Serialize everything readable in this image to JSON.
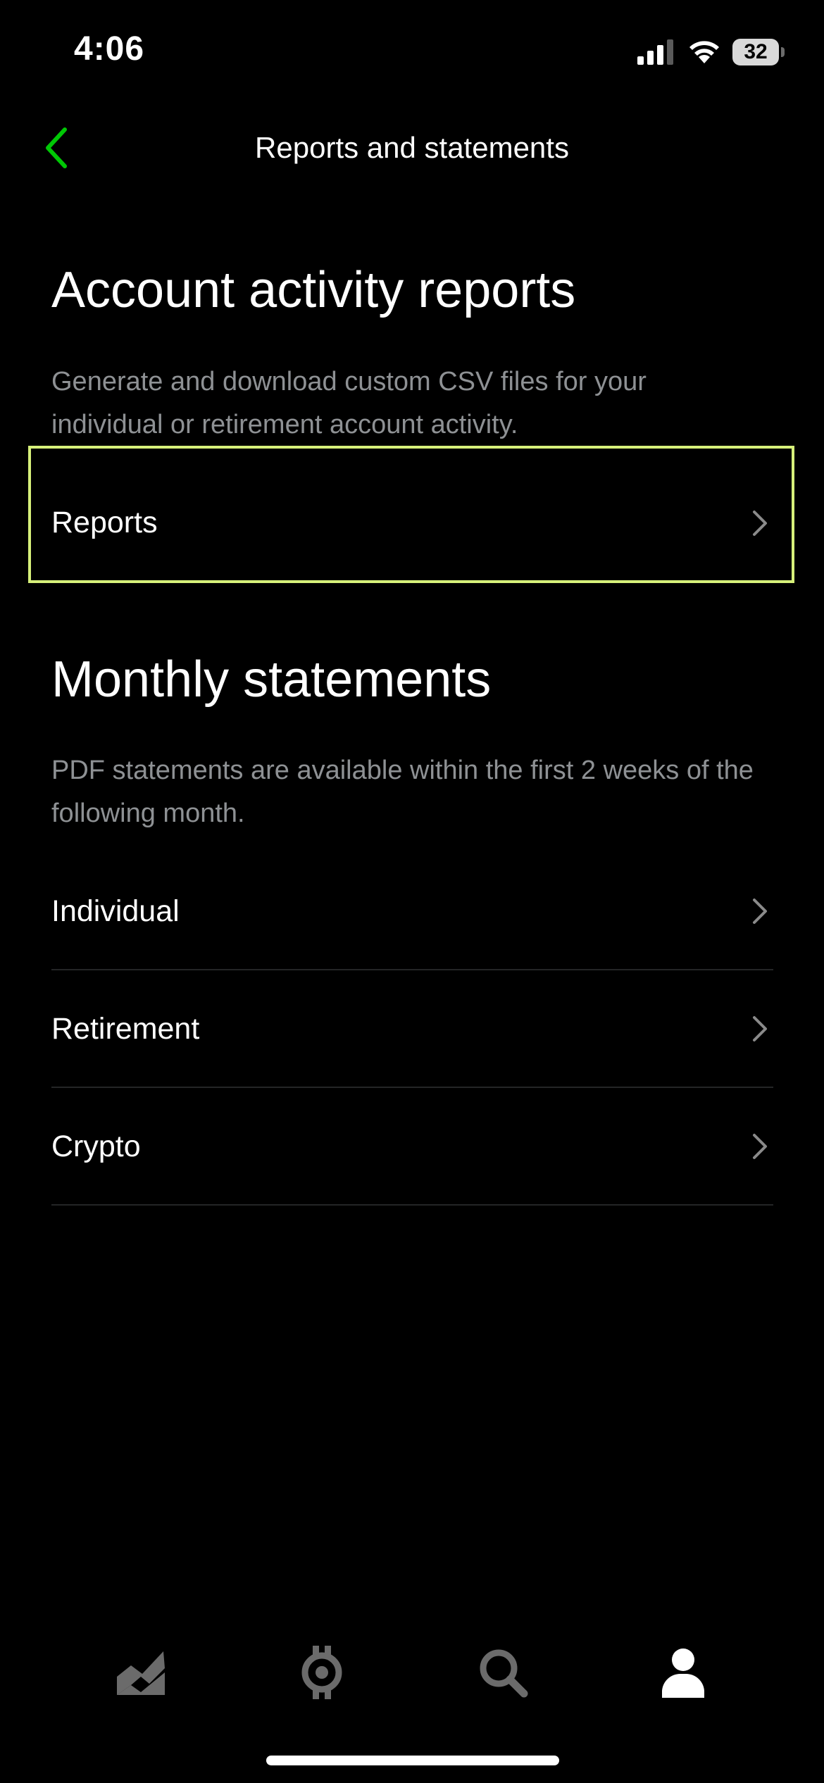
{
  "status_bar": {
    "time": "4:06",
    "battery": "32"
  },
  "header": {
    "title": "Reports and statements",
    "accent_color": "#00c805"
  },
  "activity_section": {
    "heading": "Account activity reports",
    "description": "Generate and download custom CSV files for your individual or retirement account activity.",
    "rows": [
      {
        "label": "Reports"
      }
    ]
  },
  "monthly_section": {
    "heading": "Monthly statements",
    "description": "PDF statements are available within the first 2 weeks of the following month.",
    "rows": [
      {
        "label": "Individual"
      },
      {
        "label": "Retirement"
      },
      {
        "label": "Crypto"
      }
    ]
  },
  "tab_bar": {
    "tabs": [
      {
        "icon": "chart-icon",
        "active": false
      },
      {
        "icon": "crypto-icon",
        "active": false
      },
      {
        "icon": "search-icon",
        "active": false
      },
      {
        "icon": "account-icon",
        "active": true
      }
    ],
    "active_color": "#ffffff",
    "inactive_color": "#6b6b6b"
  },
  "highlight_color": "#d6f07a"
}
